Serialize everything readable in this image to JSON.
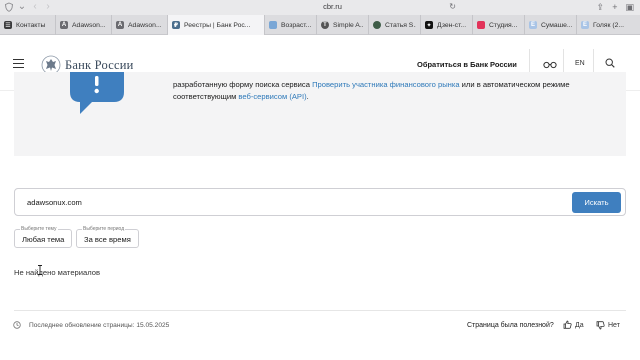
{
  "browser": {
    "url": "cbr.ru",
    "tabs": [
      {
        "label": "Контакты",
        "icon": "contacts-icon",
        "color": "#3a3a3c"
      },
      {
        "label": "Adawson...",
        "icon": "letter-a-icon",
        "color": "#6b6b70"
      },
      {
        "label": "Adawson...",
        "icon": "letter-a-icon",
        "color": "#6b6b70"
      },
      {
        "label": "Реестры | Банк Рос...",
        "icon": "bank-russia-icon",
        "color": "#4a6d8c"
      },
      {
        "label": "Возраст...",
        "icon": "image-icon",
        "color": "#7aa7d6"
      },
      {
        "label": "Simple A...",
        "icon": "t-icon",
        "color": "#555555"
      },
      {
        "label": "Статья S...",
        "icon": "globe-icon",
        "color": "#3f5d48"
      },
      {
        "label": "Дзен-ст...",
        "icon": "dzen-icon",
        "color": "#111111"
      },
      {
        "label": "Студия...",
        "icon": "studio-icon",
        "color": "#e2335a"
      },
      {
        "label": "Сумаше...",
        "icon": "letter-e-icon",
        "color": "#a9c4e6"
      },
      {
        "label": "Голяк (2...",
        "icon": "letter-e-icon",
        "color": "#a9c4e6"
      }
    ]
  },
  "header": {
    "logo_text": "Банк России",
    "contact_label": "Обратиться в Банк России",
    "lang_label": "EN"
  },
  "banner": {
    "text_before": "разработанную форму поиска сервиса ",
    "link1": "Проверить участника финансового рынка",
    "text_middle": " или в автоматическом режиме соответствующим ",
    "link2": "веб-сервисом (API)",
    "text_after": "."
  },
  "search": {
    "value": "adawsonux.com",
    "button_label": "Искать"
  },
  "filters": {
    "topic_legend": "Выберите тему",
    "topic_value": "Любая тема",
    "period_legend": "Выберите период",
    "period_value": "За все время"
  },
  "results": {
    "empty_message": "Не найдено материалов"
  },
  "footer": {
    "updated": "Последнее обновление страницы: 15.05.2025",
    "helpful_question": "Страница была полезной?",
    "yes_label": "Да",
    "no_label": "Нет"
  },
  "colors": {
    "accent": "#3f7fbf",
    "link": "#2e79b9",
    "banner_bg": "#f4f4f5"
  }
}
